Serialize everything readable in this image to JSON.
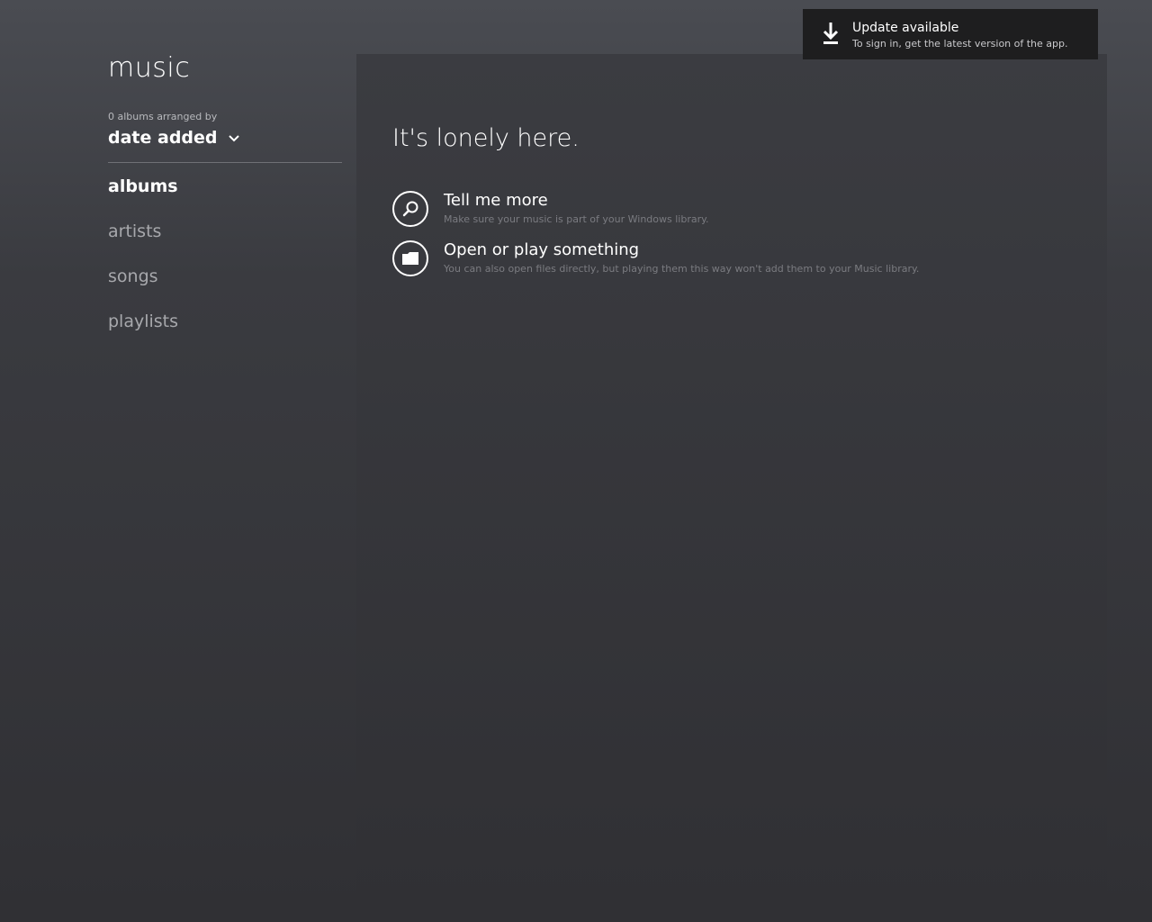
{
  "app": {
    "title": "music"
  },
  "sort": {
    "caption": "0 albums arranged by",
    "value": "date added",
    "icon": "chevron-down-icon"
  },
  "nav": {
    "items": [
      {
        "label": "albums",
        "active": true
      },
      {
        "label": "artists",
        "active": false
      },
      {
        "label": "songs",
        "active": false
      },
      {
        "label": "playlists",
        "active": false
      }
    ]
  },
  "content": {
    "heading": "It's lonely here.",
    "actions": [
      {
        "icon": "search-icon",
        "title": "Tell me more",
        "description": "Make sure your music is part of your Windows library."
      },
      {
        "icon": "folder-icon",
        "title": "Open or play something",
        "description": "You can also open files directly, but playing them this way won't add them to your Music library."
      }
    ]
  },
  "toast": {
    "icon": "download-icon",
    "title": "Update available",
    "body": "To sign in, get the latest version of the app."
  },
  "colors": {
    "background": "#3a3b40",
    "panel": "#35363a",
    "toast_bg": "#1e1e1f",
    "text_primary": "#ffffff",
    "text_muted": "#a7a8ac",
    "text_faint": "#7a7b80"
  }
}
